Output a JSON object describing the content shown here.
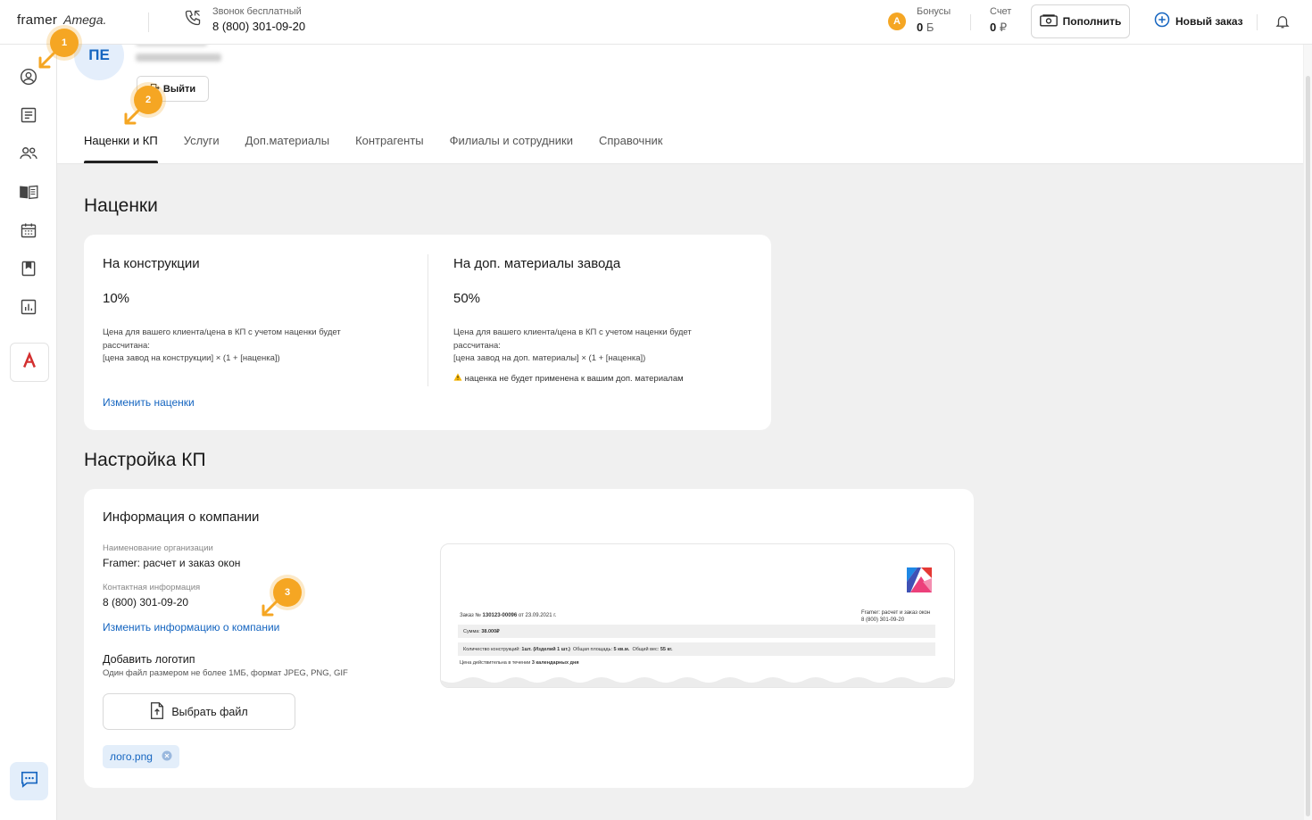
{
  "header": {
    "brand": "framer",
    "partner": "Amega.",
    "phone_label": "Звонок бесплатный",
    "phone_number": "8 (800) 301-09-20",
    "bonus_label": "Бонусы",
    "bonus_value": "0",
    "bonus_unit": "Б",
    "account_label": "Счет",
    "account_value": "0",
    "account_unit": "₽",
    "topup_label": "Пополнить",
    "new_order_label": "Новый заказ"
  },
  "sidebar": {
    "items": [
      "user-circle-icon",
      "orders-icon",
      "clients-icon",
      "catalog-book-icon",
      "calendar-icon",
      "bookmark-icon",
      "reports-chart-icon"
    ],
    "amega_letter": "A"
  },
  "profile": {
    "initials": "ПЕ",
    "logout_label": "Выйти"
  },
  "tabs": [
    {
      "label": "Наценки и КП",
      "active": true
    },
    {
      "label": "Услуги"
    },
    {
      "label": "Доп.материалы"
    },
    {
      "label": "Контрагенты"
    },
    {
      "label": "Филиалы и сотрудники"
    },
    {
      "label": "Справочник"
    }
  ],
  "markups": {
    "title": "Наценки",
    "constructions": {
      "title": "На конструкции",
      "value": "10%",
      "desc_line1": "Цена для вашего клиента/цена в КП с учетом наценки будет",
      "desc_line2": "рассчитана:",
      "desc_line3": "[цена завод на  конструкции] × (1 + [наценка])"
    },
    "materials": {
      "title": "На доп. материалы завода",
      "value": "50%",
      "desc_line1": "Цена для вашего клиента/цена в КП с учетом наценки будет",
      "desc_line2": "рассчитана:",
      "desc_line3": "[цена завод на доп. материалы] × (1 + [наценка])",
      "warning": "наценка не будет применена к вашим доп. материалам"
    },
    "edit_link": "Изменить наценки"
  },
  "kp": {
    "title": "Настройка КП",
    "card_title": "Информация о компании",
    "org_label": "Наименование организации",
    "org_value": "Framer: расчет и заказ окон",
    "contact_label": "Контактная информация",
    "contact_value": "8 (800) 301-09-20",
    "edit_link": "Изменить информацию о компании",
    "logo_title": "Добавить логотип",
    "logo_hint": "Один файл размером не более 1МБ, формат JPEG, PNG, GIF",
    "choose_file": "Выбрать файл",
    "file_name": "лого.png"
  },
  "preview": {
    "company_line1": "Framer: расчет и заказ окон",
    "company_line2": "8 (800) 301-09-20",
    "order_prefix": "Заказ №",
    "order_number": "130123-00096",
    "order_date": "от 23.09.2021 г.",
    "sum_label": "Сумма:",
    "sum_value": "38.000₽",
    "count_label": "Количество конструкций:",
    "count_value": "1шт. (Изделий 1 шт.)",
    "area_label": "Общая площадь:",
    "area_value": "5 кв.м.",
    "weight_label": "Общий вес:",
    "weight_value": "55 кг.",
    "valid_prefix": "Цена действительна в течении",
    "valid_value": "3 календарных дня"
  },
  "markers": [
    "1",
    "2",
    "3"
  ],
  "colors": {
    "accent_blue": "#1565c0",
    "marker_orange": "#f5a623",
    "background": "#f0f0f0"
  }
}
